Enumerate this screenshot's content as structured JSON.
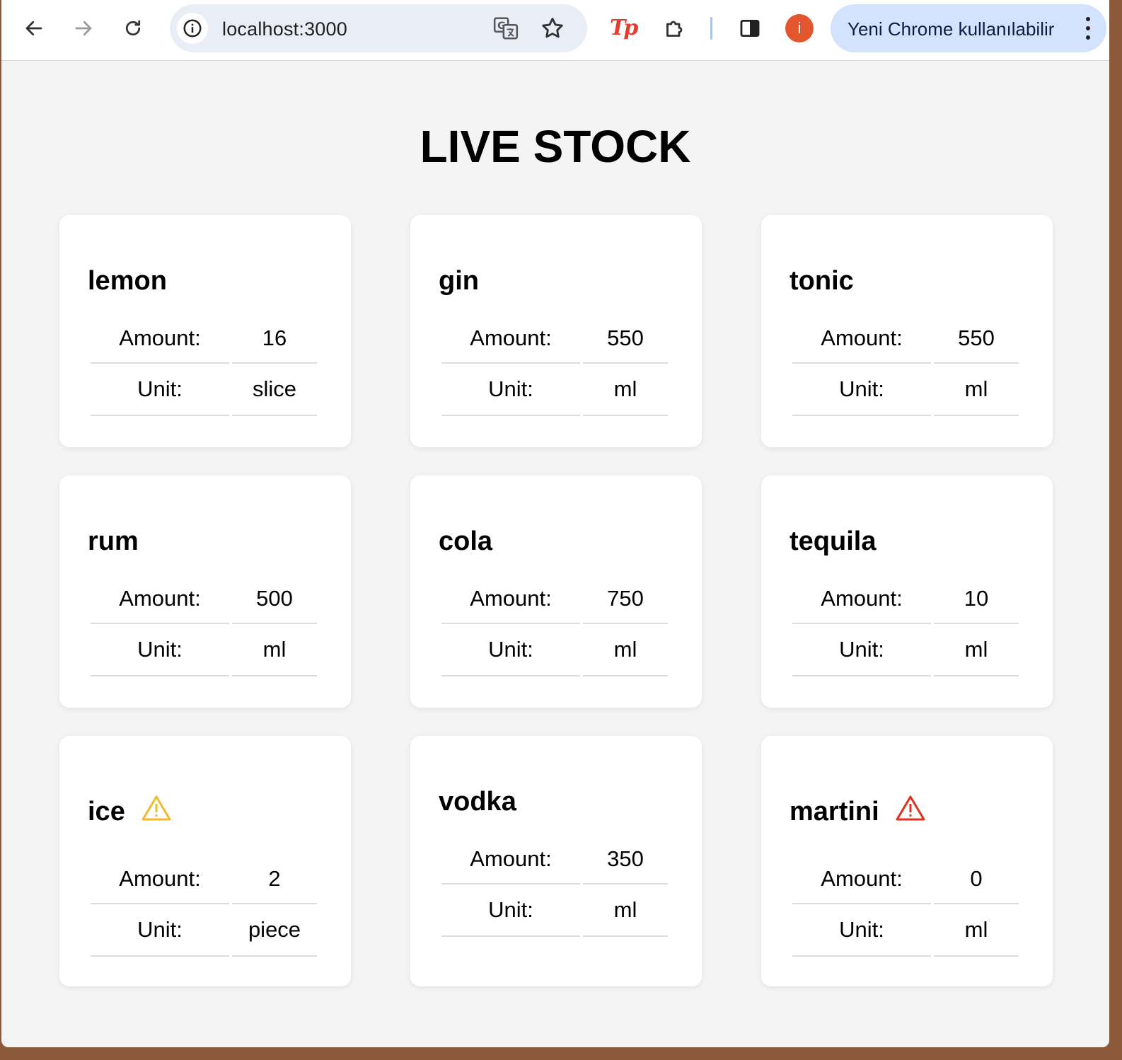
{
  "browser": {
    "url": "localhost:3000",
    "update_label": "Yeni Chrome kullanılabilir",
    "profile_initial": "i",
    "extension_label": "Tp"
  },
  "page": {
    "title": "LIVE STOCK"
  },
  "labels": {
    "amount": "Amount:",
    "unit": "Unit:"
  },
  "items": [
    {
      "name": "lemon",
      "amount": "16",
      "unit": "slice",
      "warning": "none"
    },
    {
      "name": "gin",
      "amount": "550",
      "unit": "ml",
      "warning": "none"
    },
    {
      "name": "tonic",
      "amount": "550",
      "unit": "ml",
      "warning": "none"
    },
    {
      "name": "rum",
      "amount": "500",
      "unit": "ml",
      "warning": "none"
    },
    {
      "name": "cola",
      "amount": "750",
      "unit": "ml",
      "warning": "none"
    },
    {
      "name": "tequila",
      "amount": "10",
      "unit": "ml",
      "warning": "none"
    },
    {
      "name": "ice",
      "amount": "2",
      "unit": "piece",
      "warning": "low"
    },
    {
      "name": "vodka",
      "amount": "350",
      "unit": "ml",
      "warning": "none"
    },
    {
      "name": "martini",
      "amount": "0",
      "unit": "ml",
      "warning": "empty"
    }
  ],
  "colors": {
    "warning_low": "#f2b92e",
    "warning_empty": "#e0301e",
    "page_background": "#f4f4f4",
    "card_background": "#ffffff"
  }
}
